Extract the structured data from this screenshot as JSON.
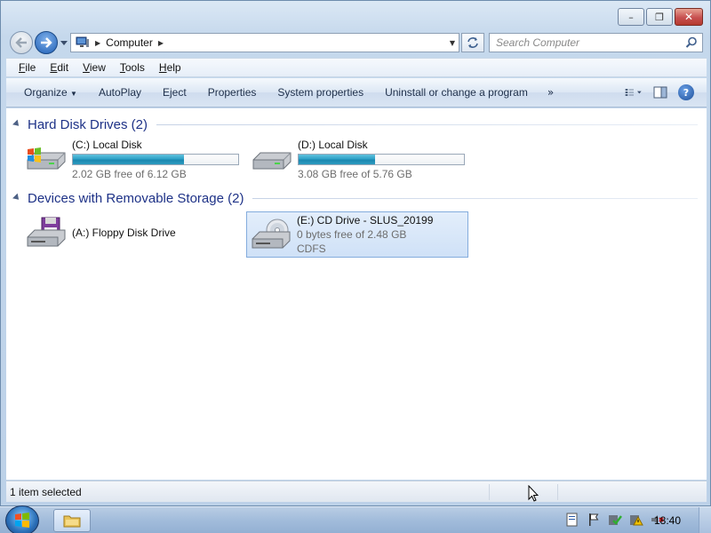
{
  "window": {
    "title_buttons": [
      "minimize",
      "maximize",
      "close"
    ]
  },
  "address": {
    "path": "Computer",
    "search_placeholder": "Search Computer"
  },
  "menu": {
    "items": [
      {
        "label": "File",
        "underline": "F",
        "rest": "ile"
      },
      {
        "label": "Edit",
        "underline": "E",
        "rest": "dit"
      },
      {
        "label": "View",
        "underline": "V",
        "rest": "iew"
      },
      {
        "label": "Tools",
        "underline": "T",
        "rest": "ools"
      },
      {
        "label": "Help",
        "underline": "H",
        "rest": "elp"
      }
    ]
  },
  "commandbar": {
    "organize": "Organize",
    "autoplay": "AutoPlay",
    "eject": "Eject",
    "properties": "Properties",
    "system_properties": "System properties",
    "uninstall": "Uninstall or change a program",
    "more": "»"
  },
  "groups": {
    "hdd": {
      "title": "Hard Disk Drives (2)"
    },
    "removable": {
      "title": "Devices with Removable Storage (2)"
    }
  },
  "drives": {
    "c": {
      "name": "(C:) Local Disk",
      "free_text": "2.02 GB free of 6.12 GB",
      "used_fraction": 0.67
    },
    "d": {
      "name": "(D:) Local Disk",
      "free_text": "3.08 GB free of 5.76 GB",
      "used_fraction": 0.46
    },
    "a": {
      "name": "(A:) Floppy Disk Drive"
    },
    "e": {
      "name": "(E:) CD Drive - SLUS_20199",
      "free_text": "0 bytes free of 2.48 GB",
      "filesystem": "CDFS"
    }
  },
  "status": {
    "text": "1 item selected"
  },
  "taskbar": {
    "clock": "18:40"
  },
  "colors": {
    "group_title": "#1e3287",
    "usage_bar": "#2ea1c7",
    "selection": "#cfe1f7"
  }
}
